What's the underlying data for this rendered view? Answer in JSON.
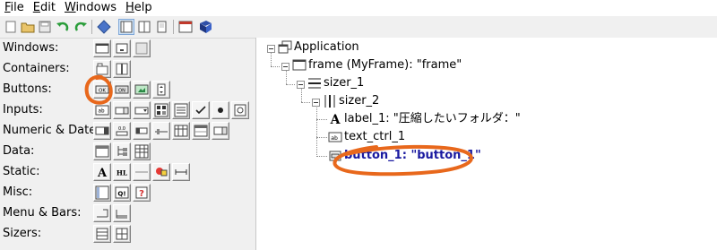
{
  "menubar": {
    "items": [
      "File",
      "Edit",
      "Windows",
      "Help"
    ],
    "mnemonics": [
      "F",
      "E",
      "W",
      "H"
    ]
  },
  "toolbar": {
    "buttons": [
      "new-file-icon",
      "open-folder-icon",
      "save-icon",
      "undo-icon",
      "redo-icon",
      "diamond-icon",
      "layout-window-icon",
      "layout-dialog-icon",
      "layout-phone-icon",
      "preview-window-icon",
      "help-book-icon"
    ]
  },
  "palette": {
    "rows": [
      {
        "label": "Windows:",
        "items": [
          "frame-icon",
          "dialog-icon",
          "panel-icon"
        ]
      },
      {
        "label": "Containers:",
        "items": [
          "notebook-icon",
          "splitter-icon"
        ]
      },
      {
        "label": "Buttons:",
        "items": [
          "button-icon",
          "toggle-button-icon",
          "bitmap-button-icon",
          "spin-button-icon"
        ]
      },
      {
        "label": "Inputs:",
        "items": [
          "text-ctrl-icon",
          "combo-box-icon",
          "choice-icon",
          "list-box-icon",
          "checkbox-icon",
          "radio-button-icon",
          "search-ctrl-icon"
        ]
      },
      {
        "label": "Numeric & Dates:",
        "items": [
          "spin-ctrl-icon",
          "slider-icon",
          "gauge-icon",
          "grid-icon",
          "calendar-icon",
          "date-picker-icon"
        ]
      },
      {
        "label": "Data:",
        "items": [
          "list-ctrl-icon",
          "tree-ctrl-icon",
          "grid-data-icon"
        ]
      },
      {
        "label": "Static:",
        "items": [
          "static-text-icon",
          "hyperlink-icon",
          "static-line-icon",
          "static-bitmap-icon",
          "spacer-icon"
        ]
      },
      {
        "label": "Misc:",
        "items": [
          "custom-widget-icon",
          "html-window-icon",
          "unknown-widget-icon"
        ]
      },
      {
        "label": "Menu & Bars:",
        "items": [
          "menubar-icon",
          "statusbar-icon"
        ]
      },
      {
        "label": "Sizers:",
        "items": [
          "box-sizer-icon",
          "grid-sizer-icon"
        ]
      }
    ]
  },
  "tree": {
    "nodes": [
      {
        "label": "Application"
      },
      {
        "label": "frame (MyFrame): \"frame\""
      },
      {
        "label": "sizer_1"
      },
      {
        "label": "sizer_2"
      },
      {
        "label": "label_1: \"圧縮したいフォルダ：\""
      },
      {
        "label": "text_ctrl_1"
      },
      {
        "label": "button_1: \"button_1\""
      }
    ]
  },
  "colors": {
    "annotation": "#e8681c",
    "selected_text": "#1a1aa0"
  }
}
